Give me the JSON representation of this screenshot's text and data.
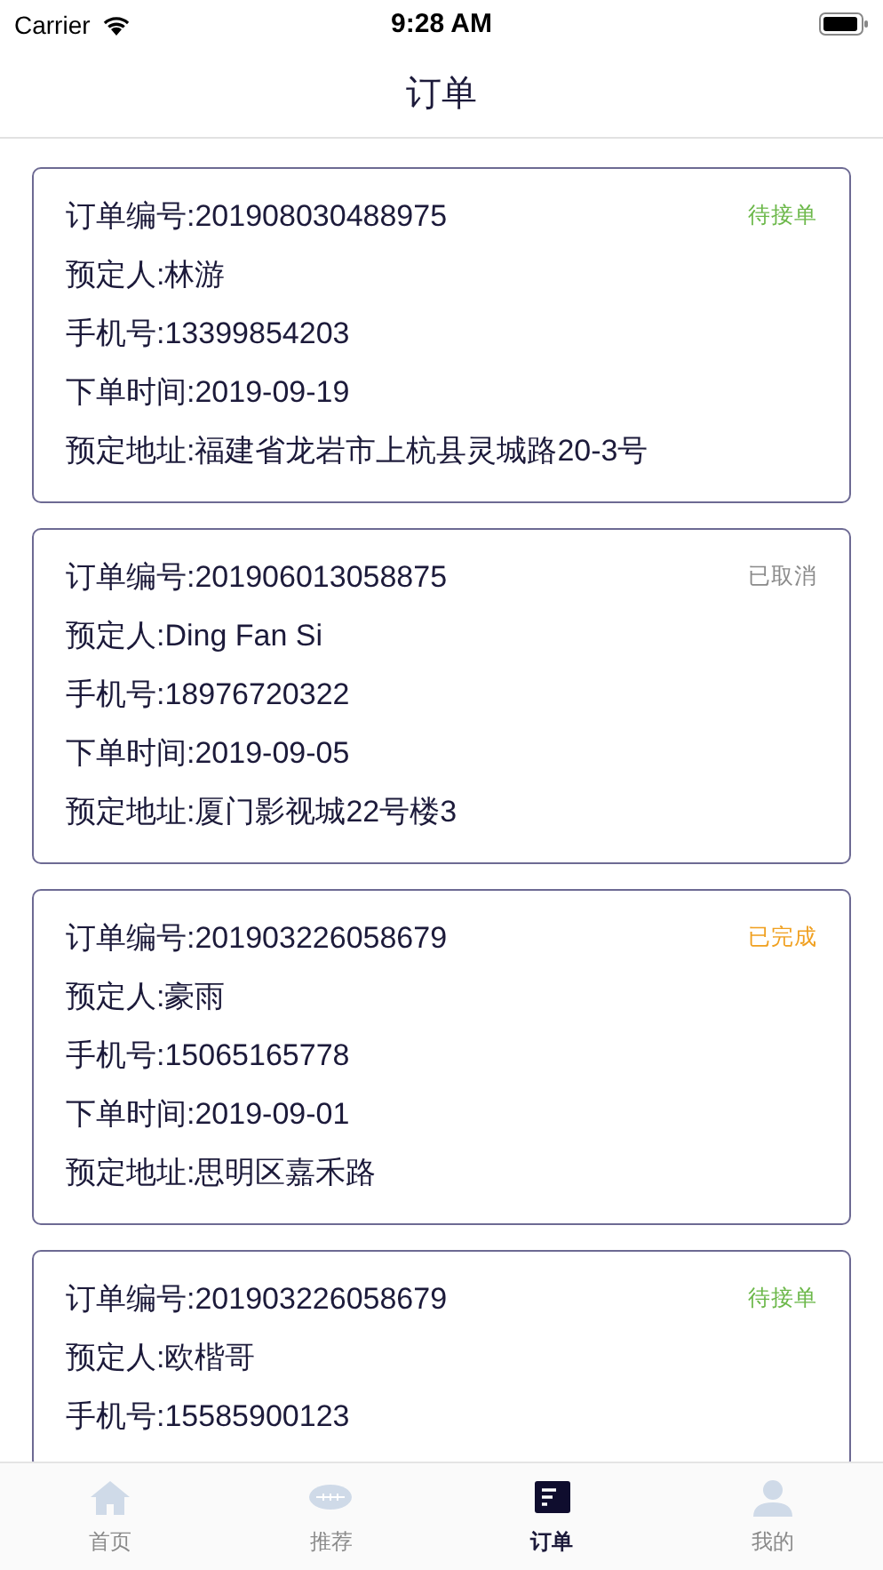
{
  "status_bar": {
    "carrier": "Carrier",
    "time": "9:28 AM"
  },
  "nav_bar": {
    "title": "订单"
  },
  "orders": [
    {
      "lines": [
        "订单编号:201908030488975",
        "预定人:林游",
        "手机号:13399854203",
        "下单时间:2019-09-19",
        "预定地址:福建省龙岩市上杭县灵城路20-3号"
      ],
      "status": {
        "label": "待接单",
        "color": "#6cb84a"
      }
    },
    {
      "lines": [
        "订单编号:201906013058875",
        "预定人:Ding Fan Si",
        "手机号:18976720322",
        "下单时间:2019-09-05",
        "预定地址:厦门影视城22号楼3"
      ],
      "status": {
        "label": "已取消",
        "color": "#8a8a8a"
      }
    },
    {
      "lines": [
        "订单编号:201903226058679",
        "预定人:豪雨",
        "手机号:15065165778",
        "下单时间:2019-09-01",
        "预定地址:思明区嘉禾路"
      ],
      "status": {
        "label": "已完成",
        "color": "#f0a020"
      }
    },
    {
      "lines": [
        "订单编号:201903226058679",
        "预定人:欧楷哥",
        "手机号:15585900123"
      ],
      "status": {
        "label": "待接单",
        "color": "#6cb84a"
      }
    }
  ],
  "tab_bar": {
    "items": [
      {
        "label": "首页",
        "kind": "home",
        "selected": false
      },
      {
        "label": "推荐",
        "kind": "ball",
        "selected": false
      },
      {
        "label": "订单",
        "kind": "orders",
        "selected": true
      },
      {
        "label": "我的",
        "kind": "person",
        "selected": false
      }
    ]
  }
}
